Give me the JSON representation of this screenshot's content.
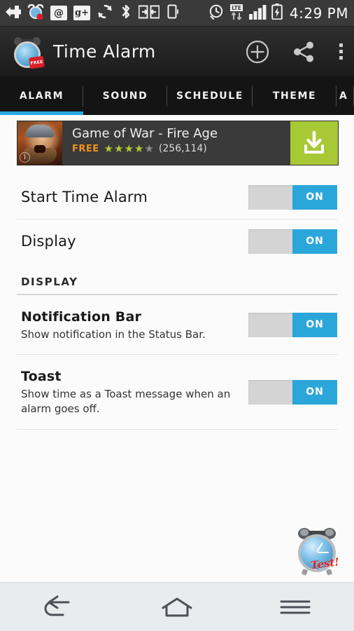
{
  "statusbar": {
    "icons_left": [
      "cross-plus-icon",
      "alarm-clock-icon",
      "email-at-icon",
      "google-plus-icon",
      "sync-icon"
    ],
    "icons_right": [
      "clock-icon",
      "lte-data-icon",
      "signal-bars-icon",
      "battery-charging-icon"
    ],
    "email_glyph": "@",
    "gplus_glyph": "g+",
    "lte_label": "LTE",
    "time": "4:29 PM"
  },
  "appbar": {
    "title": "Time Alarm",
    "logo_badge": "FREE",
    "actions": [
      {
        "name": "add-alarm-button",
        "icon": "plus-circle-icon"
      },
      {
        "name": "share-button",
        "icon": "share-icon"
      },
      {
        "name": "overflow-menu-button",
        "icon": "kebab-menu-icon"
      }
    ]
  },
  "tabs": {
    "items": [
      {
        "label": "ALARM",
        "selected": true
      },
      {
        "label": "SOUND",
        "selected": false
      },
      {
        "label": "SCHEDULE",
        "selected": false
      },
      {
        "label": "THEME",
        "selected": false
      },
      {
        "label": "A",
        "selected": false
      }
    ],
    "accent_color": "#28a9e0"
  },
  "ad": {
    "title": "Game of War - Fire Age",
    "price": "FREE",
    "rating": 4,
    "rating_max": 5,
    "review_count": "(256,114)",
    "star_filled_glyph": "★",
    "star_empty_glyph": "★",
    "info_glyph": "i",
    "download_icon": "download-icon",
    "download_color": "#a8c936",
    "free_color": "#f0941e",
    "star_color": "#b3c833"
  },
  "settings": {
    "rows": [
      {
        "title": "Start Time Alarm",
        "desc": "",
        "toggle": "ON"
      },
      {
        "title": "Display",
        "desc": "",
        "toggle": "ON"
      }
    ],
    "section_title": "DISPLAY",
    "section_rows": [
      {
        "title": "Notification Bar",
        "desc": "Show notification in the Status Bar.",
        "toggle": "ON"
      },
      {
        "title": "Toast",
        "desc": "Show time as a Toast message when an alarm goes off.",
        "toggle": "ON"
      }
    ],
    "toggle_on_color": "#2ba6da",
    "toggle_track_color": "#d4d4d4"
  },
  "fab": {
    "label": "Test!",
    "icon": "alarm-clock-test-icon"
  },
  "navbar": {
    "buttons": [
      {
        "name": "nav-back-button",
        "icon": "back-arrow-icon"
      },
      {
        "name": "nav-home-button",
        "icon": "home-icon"
      },
      {
        "name": "nav-recents-button",
        "icon": "recent-apps-icon"
      }
    ]
  }
}
